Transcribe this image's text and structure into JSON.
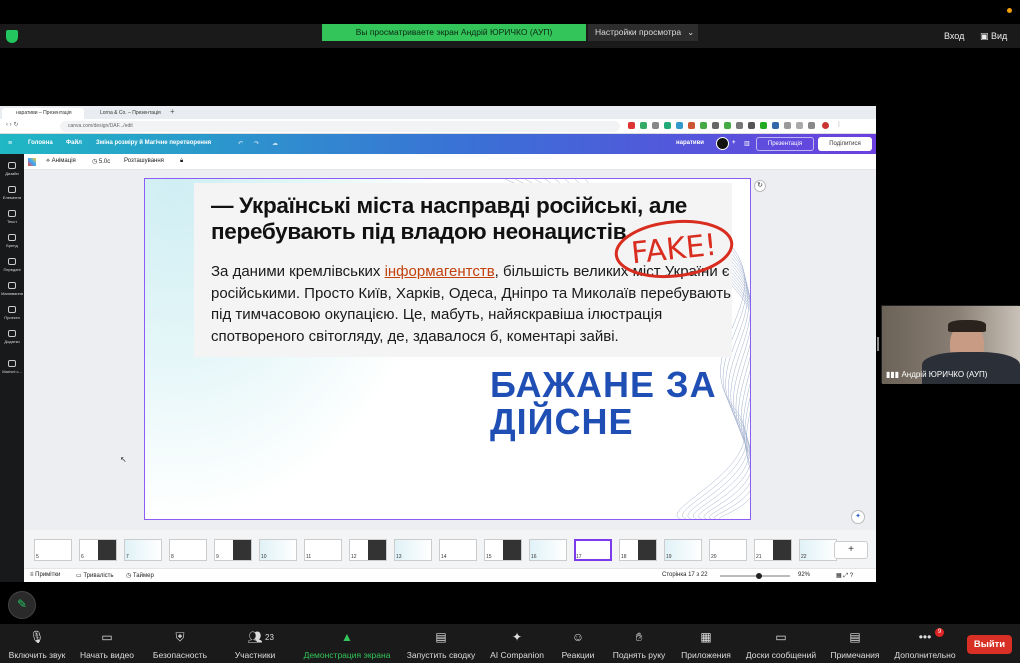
{
  "zoom": {
    "share_banner": "Вы просматриваете экран Андрій ЮРИЧКО (АУП)",
    "view_options": "Настройки просмотра",
    "exit_label": "Вход",
    "view_label": "Вид",
    "participant_name": "Андрій ЮРИЧКО (АУП)",
    "participant_count": "23",
    "more_badge": "9",
    "leave_label": "Выйти",
    "toolbar": [
      {
        "label": "Включить звук",
        "icon": "mic-muted-icon"
      },
      {
        "label": "Начать видео",
        "icon": "video-off-icon"
      },
      {
        "label": "Безопасность",
        "icon": "shield-icon"
      },
      {
        "label": "Участники",
        "icon": "participants-icon"
      },
      {
        "label": "Демонстрация экрана",
        "icon": "share-screen-icon"
      },
      {
        "label": "Запустить сводку",
        "icon": "summary-icon"
      },
      {
        "label": "AI Companion",
        "icon": "sparkle-icon"
      },
      {
        "label": "Реакции",
        "icon": "reaction-icon"
      },
      {
        "label": "Поднять руку",
        "icon": "hand-icon"
      },
      {
        "label": "Приложения",
        "icon": "apps-icon"
      },
      {
        "label": "Доски сообщений",
        "icon": "whiteboard-icon"
      },
      {
        "label": "Примечания",
        "icon": "notes-icon"
      },
      {
        "label": "Дополнительно",
        "icon": "more-icon"
      }
    ],
    "accent": "#33c45a"
  },
  "browser": {
    "tabs": [
      "наративи – Презентація",
      "Lorna & Co. – Презентація"
    ],
    "url": "canva.com/design/DAF.../edit"
  },
  "canva": {
    "menu": [
      "Головна",
      "Файл",
      "Зміна розміру й Магічне перетворення"
    ],
    "doc_name": "наративи",
    "present_label": "Презентація",
    "share_label": "Поділитися",
    "toolbar": {
      "animation": "Анімація",
      "duration": "5.0с",
      "position": "Розташування"
    },
    "sidebar": [
      "Дизайн",
      "Елементи",
      "Текст",
      "Бренд",
      "Передані",
      "Малювання",
      "Проекти",
      "Додатки",
      "Магічні с..."
    ],
    "status": {
      "notes": "Примітки",
      "duration": "Тривалість",
      "timer": "Таймер",
      "page": "Сторінка 17 з 22",
      "zoom": "92%"
    },
    "thumbnails": [
      "5",
      "6",
      "7",
      "8",
      "9",
      "10",
      "11",
      "12",
      "13",
      "14",
      "15",
      "16",
      "17",
      "18",
      "19",
      "20",
      "21",
      "22"
    ],
    "current_page": "17"
  },
  "slide": {
    "title": "— Українські міста насправді російські, але перебувають під владою неонацистів",
    "body_before": "За даними кремлівських ",
    "body_link": "інформагентств",
    "body_after": ", більшість великих міст України є російськими. Просто Київ, Харків, Одеса, Дніпро та Миколаїв перебувають під тимчасовою окупацією. Це, мабуть, найяскравіша ілюстрація спотвореного світогляду, де, здавалося б, коментарі зайві.",
    "stamp": "FAKE!",
    "slogan_line1": "БАЖАНЕ ЗА",
    "slogan_line2": "ДІЙСНЕ",
    "slogan_color": "#1f4fb5",
    "stamp_color": "#d92d20"
  }
}
